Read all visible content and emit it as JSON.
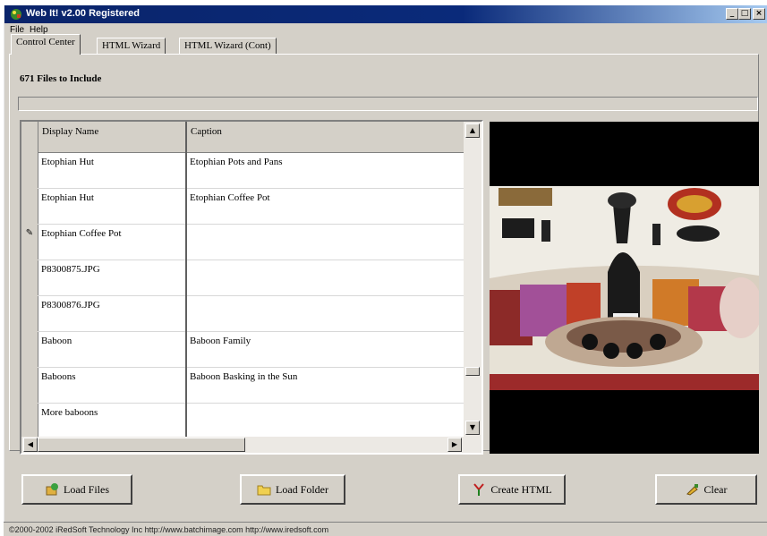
{
  "window": {
    "title": "Web It!  v2.00 Registered"
  },
  "titlebar_buttons": {
    "minimize": "_",
    "maximize": "□",
    "close": "×"
  },
  "menu": {
    "file": "File",
    "help": "Help"
  },
  "tabs": [
    {
      "label": "Control Center"
    },
    {
      "label": "HTML Wizard"
    },
    {
      "label": "HTML Wizard (Cont)"
    }
  ],
  "files_label": "671 Files to Include",
  "grid": {
    "headers": {
      "display_name": "Display Name",
      "caption": "Caption"
    },
    "rows": [
      {
        "display_name": "Etophian Hut",
        "caption": "Etophian Pots and Pans"
      },
      {
        "display_name": "Etophian Hut",
        "caption": "Etophian Coffee Pot"
      },
      {
        "display_name": "Etophian Coffee Pot",
        "caption": "",
        "editing": true
      },
      {
        "display_name": "P8300875.JPG",
        "caption": ""
      },
      {
        "display_name": "P8300876.JPG",
        "caption": ""
      },
      {
        "display_name": "Baboon",
        "caption": "Baboon Family"
      },
      {
        "display_name": "Baboons",
        "caption": "Baboon Basking in the Sun"
      },
      {
        "display_name": "More baboons",
        "caption": ""
      }
    ],
    "edit_marker": "✎"
  },
  "buttons": {
    "load_files": "Load Files",
    "load_folder": "Load Folder",
    "create_html": "Create HTML",
    "clear": "Clear"
  },
  "status": "©2000-2002 iRedSoft Technology Inc  http://www.batchimage.com http://www.iredsoft.com",
  "icons": {
    "app": "web-it-app-icon",
    "load_files": "load-files-icon",
    "load_folder": "folder-icon",
    "create_html": "create-html-icon",
    "clear": "clear-icon"
  }
}
